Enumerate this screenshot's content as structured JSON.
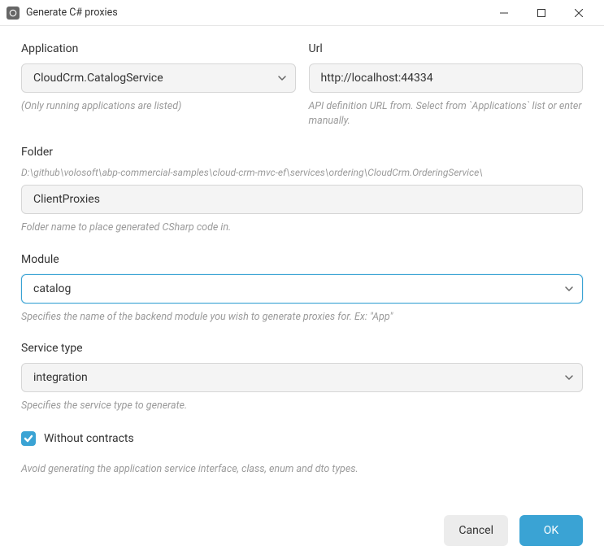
{
  "window": {
    "title": "Generate C# proxies"
  },
  "application": {
    "label": "Application",
    "value": "CloudCrm.CatalogService",
    "help": "(Only running applications are listed)"
  },
  "url": {
    "label": "Url",
    "value": "http://localhost:44334",
    "help": "API definition URL from. Select from `Applications` list or enter manually."
  },
  "folder": {
    "label": "Folder",
    "path": "D:\\github\\volosoft\\abp-commercial-samples\\cloud-crm-mvc-ef\\services\\ordering\\CloudCrm.OrderingService\\",
    "value": "ClientProxies",
    "help": "Folder name to place generated CSharp code in."
  },
  "module": {
    "label": "Module",
    "value": "catalog",
    "help": "Specifies the name of the backend module you wish to generate proxies for. Ex: \"App\""
  },
  "serviceType": {
    "label": "Service type",
    "value": "integration",
    "help": "Specifies the service type to generate."
  },
  "withoutContracts": {
    "label": "Without contracts",
    "checked": true,
    "help": "Avoid generating the application service interface, class, enum and dto types."
  },
  "buttons": {
    "cancel": "Cancel",
    "ok": "OK"
  }
}
